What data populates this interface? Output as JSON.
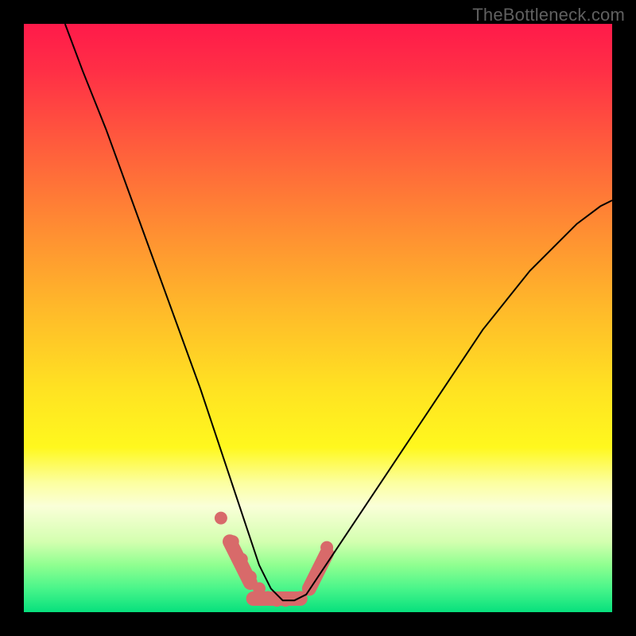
{
  "watermark": "TheBottleneck.com",
  "colors": {
    "frame_bg": "#000000",
    "curve": "#000000",
    "marker_fill": "#d86a6a",
    "gradient_top": "#ff1a4a",
    "gradient_bottom": "#07e07d"
  },
  "chart_data": {
    "type": "line",
    "title": "",
    "xlabel": "",
    "ylabel": "",
    "xlim": [
      0,
      100
    ],
    "ylim": [
      0,
      100
    ],
    "grid": false,
    "legend": false,
    "note": "x and y on 0–100 scale; x0≈7 y0=100 down to minimum y≈2 at x≈41, plateau to x≈47, then rising to y≈70 at x=100",
    "series": [
      {
        "name": "bottleneck-curve",
        "x": [
          7,
          10,
          14,
          18,
          22,
          26,
          30,
          32,
          34,
          36,
          38,
          40,
          42,
          44,
          46,
          48,
          50,
          54,
          58,
          62,
          66,
          70,
          74,
          78,
          82,
          86,
          90,
          94,
          98,
          100
        ],
        "y": [
          100,
          92,
          82,
          71,
          60,
          49,
          38,
          32,
          26,
          20,
          14,
          8,
          4,
          2,
          2,
          3,
          6,
          12,
          18,
          24,
          30,
          36,
          42,
          48,
          53,
          58,
          62,
          66,
          69,
          70
        ]
      }
    ],
    "markers": {
      "note": "salmon dots/lozenges near the valley floor",
      "points_x": [
        33.5,
        35.5,
        37.0,
        38.5,
        40.0,
        41.5,
        43.0,
        44.5,
        47.0,
        49.0,
        50.5,
        51.5
      ],
      "points_y": [
        16,
        12,
        9,
        6,
        4,
        2.5,
        2,
        2,
        2.5,
        5,
        8,
        11
      ],
      "plateau": {
        "x_start": 39,
        "x_end": 47,
        "y": 2.3
      },
      "right_lozenge": {
        "x_start": 48.5,
        "x_end": 51.5,
        "y_start": 4,
        "y_end": 10
      }
    }
  }
}
